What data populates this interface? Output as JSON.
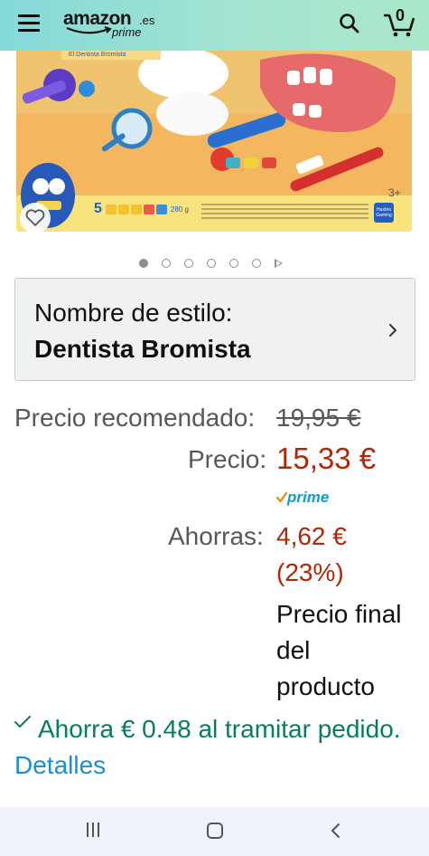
{
  "header": {
    "logo_word": "amazon",
    "logo_tld": ".es",
    "logo_prime": "prime",
    "cart_count": "0"
  },
  "product_image": {
    "box_title": "El Dentista Bromista",
    "count_label": "5",
    "weight_label": "280 g",
    "age_label": "3+",
    "brand_label": "Hasbro Gaming"
  },
  "carousel": {
    "total_dots": 6,
    "active_index": 0
  },
  "style": {
    "label": "Nombre de estilo:",
    "value": "Dentista Bromista"
  },
  "pricing": {
    "list_label": "Precio recomendado:",
    "list_price": "19,95 €",
    "price_label": "Precio:",
    "price_value": "15,33 €",
    "prime_label": "prime",
    "save_label": "Ahorras:",
    "save_amount": "4,62 €",
    "save_pct": "(23%)",
    "final_line1": "Precio final",
    "final_line2": "del",
    "final_line3": "producto"
  },
  "checkout": {
    "text": "Ahorra € 0.48 al tramitar pedido.",
    "link": "Detalles"
  },
  "colors": {
    "price_red": "#b12704",
    "muted_text": "#565959",
    "link_blue": "#1a8fd1",
    "success_green": "#067d62",
    "prime_blue": "#1399d6"
  }
}
